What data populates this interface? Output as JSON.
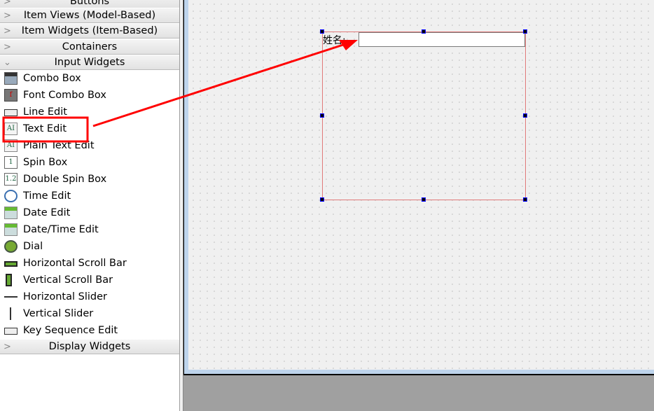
{
  "sidebar": {
    "categories_top": [
      {
        "label": "Buttons",
        "expanded": false
      },
      {
        "label": "Item Views (Model-Based)",
        "expanded": false
      },
      {
        "label": "Item Widgets (Item-Based)",
        "expanded": false
      },
      {
        "label": "Containers",
        "expanded": false
      },
      {
        "label": "Input Widgets",
        "expanded": true
      }
    ],
    "items": [
      {
        "label": "Combo Box",
        "icon": "combo-box-icon"
      },
      {
        "label": "Font Combo Box",
        "icon": "font-combo-box-icon"
      },
      {
        "label": "Line Edit",
        "icon": "line-edit-icon"
      },
      {
        "label": "Text Edit",
        "icon": "text-edit-icon"
      },
      {
        "label": "Plain Text Edit",
        "icon": "plain-text-edit-icon"
      },
      {
        "label": "Spin Box",
        "icon": "spin-box-icon"
      },
      {
        "label": "Double Spin Box",
        "icon": "double-spin-box-icon"
      },
      {
        "label": "Time Edit",
        "icon": "clock-icon"
      },
      {
        "label": "Date Edit",
        "icon": "calendar-icon"
      },
      {
        "label": "Date/Time Edit",
        "icon": "calendar-clock-icon"
      },
      {
        "label": "Dial",
        "icon": "dial-icon"
      },
      {
        "label": "Horizontal Scroll Bar",
        "icon": "horizontal-scrollbar-icon"
      },
      {
        "label": "Vertical Scroll Bar",
        "icon": "vertical-scrollbar-icon"
      },
      {
        "label": "Horizontal Slider",
        "icon": "horizontal-slider-icon"
      },
      {
        "label": "Vertical Slider",
        "icon": "vertical-slider-icon"
      },
      {
        "label": "Key Sequence Edit",
        "icon": "key-sequence-edit-icon"
      }
    ],
    "category_bottom": {
      "label": "Display Widgets",
      "expanded": false
    }
  },
  "form": {
    "label": "姓名:",
    "line_edit_value": ""
  },
  "annotation": {
    "color": "#ff0000",
    "highlighted_item": "Text Edit"
  }
}
